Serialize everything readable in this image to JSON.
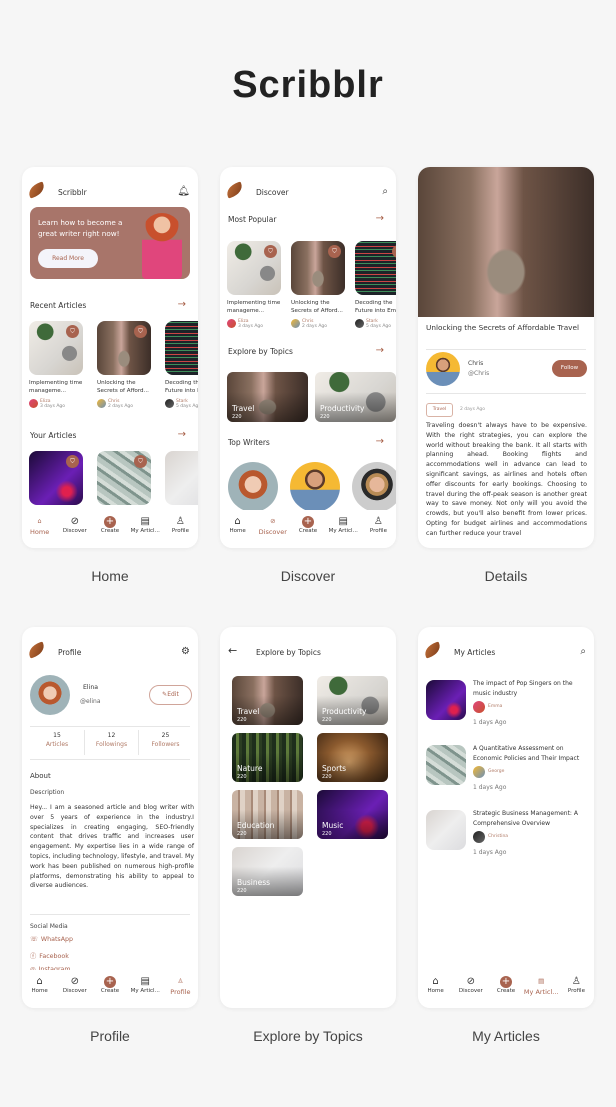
{
  "app_title": "Scribblr",
  "captions": [
    "Home",
    "Discover",
    "Details",
    "Profile",
    "Explore by Topics",
    "My Articles"
  ],
  "nav": [
    {
      "label": "Home",
      "icon": "home-icon"
    },
    {
      "label": "Discover",
      "icon": "compass-icon"
    },
    {
      "label": "Create",
      "icon": "plus-circle-icon"
    },
    {
      "label": "My Articl...",
      "icon": "newspaper-icon"
    },
    {
      "label": "Profile",
      "icon": "user-icon"
    }
  ],
  "brand_color": "#a8634f",
  "home": {
    "title": "Scribblr",
    "banner_text": "Learn how to become a great writer right now!",
    "read_more": "Read More",
    "recent_title": "Recent Articles",
    "recent": [
      {
        "title": "Implementing time manageme...",
        "author": "Eliza",
        "date": "3 days Ago",
        "image": "desk"
      },
      {
        "title": "Unlocking the Secrets of Afford...",
        "author": "Chris",
        "date": "2 days Ago",
        "image": "alley"
      },
      {
        "title": "Decoding the Future into Em...",
        "author": "Stark",
        "date": "5 days Ago",
        "image": "code"
      }
    ],
    "your_title": "Your Articles",
    "yours": [
      {
        "image": "music"
      },
      {
        "image": "money"
      },
      {
        "image": "business"
      }
    ]
  },
  "discover": {
    "title": "Discover",
    "popular_title": "Most Popular",
    "topics_title": "Explore by Topics",
    "writers_title": "Top Writers"
  },
  "details": {
    "title": "Unlocking the Secrets of Affordable Travel",
    "author": "Chris",
    "handle": "@Chris",
    "follow": "Follow",
    "tag": "Travel",
    "date": "2 days Ago",
    "body": "Traveling doesn't always have to be expensive. With the right strategies, you can explore the world without breaking the bank. It all starts with planning ahead. Booking flights and accommodations well in advance can lead to significant savings, as airlines and hotels often offer discounts for early bookings. Choosing to travel during the off-peak season is another great way to save money. Not only will you avoid the crowds, but you'll also benefit from lower prices. Opting for budget airlines and accommodations can further reduce your travel"
  },
  "profile": {
    "title": "Profile",
    "name": "Elina",
    "handle": "@elina",
    "edit": "Edit",
    "stats": [
      {
        "value": "15",
        "label": "Articles"
      },
      {
        "value": "12",
        "label": "Followings"
      },
      {
        "value": "25",
        "label": "Followers"
      }
    ],
    "about": "About",
    "description_label": "Description",
    "description": "Hey... I am a seasoned article and blog writer with over 5 years of experience in the industry.I specializes in creating engaging, SEO-friendly content that drives traffic and increases user engagement. My expertise lies in a wide range of topics, including technology, lifestyle, and travel. My work has been published on numerous high-profile platforms, demonstrating his ability to appeal to diverse audiences.",
    "social_title": "Social Media",
    "social": [
      "WhatsApp",
      "Facebook",
      "Instagram"
    ]
  },
  "topics": {
    "title": "Explore by Topics",
    "items": [
      {
        "name": "Travel",
        "count": "220",
        "image": "alley"
      },
      {
        "name": "Productivity",
        "count": "220",
        "image": "desk"
      },
      {
        "name": "Nature",
        "count": "220",
        "image": "forest"
      },
      {
        "name": "Sports",
        "count": "220",
        "image": "sports"
      },
      {
        "name": "Education",
        "count": "220",
        "image": "education"
      },
      {
        "name": "Music",
        "count": "220",
        "image": "music"
      },
      {
        "name": "Business",
        "count": "220",
        "image": "business"
      }
    ]
  },
  "my_articles": {
    "title": "My Articles",
    "items": [
      {
        "title": "The impact of Pop Singers on the music industry",
        "author": "Emma",
        "date": "1 days Ago",
        "image": "music"
      },
      {
        "title": "A Quantitative Assessment on Economic Policies and Their Impact",
        "author": "George",
        "date": "1 days Ago",
        "image": "money"
      },
      {
        "title": "Strategic Business Management: A Comprehensive Overview",
        "author": "Christina",
        "date": "1 days Ago",
        "image": "business"
      }
    ]
  }
}
